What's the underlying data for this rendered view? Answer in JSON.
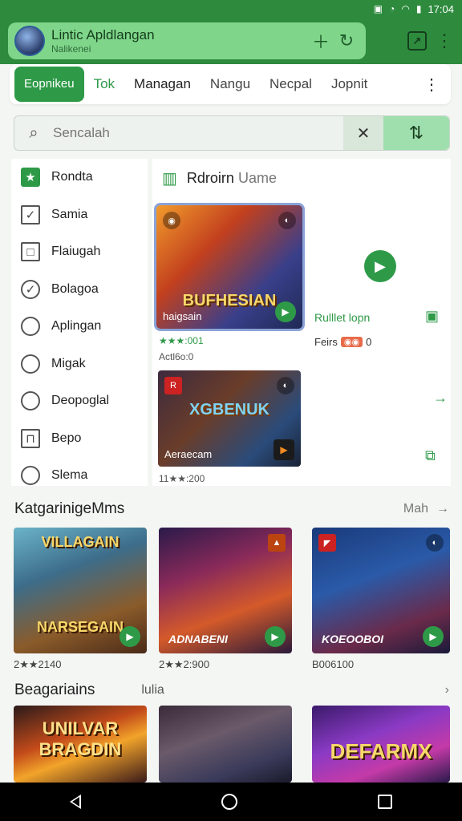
{
  "status": {
    "time": "17:04"
  },
  "header": {
    "title": "Lintic Apldlangan",
    "subtitle": "Nalikenei"
  },
  "tabs": [
    "Eopnikeu",
    "Tok",
    "Managan",
    "Nangu",
    "Necpal",
    "Jopnit"
  ],
  "search": {
    "placeholder": "Sencalah"
  },
  "sidebar": {
    "items": [
      {
        "label": "Rondta",
        "icon": "star-icon"
      },
      {
        "label": "Samia",
        "icon": "check-square-icon"
      },
      {
        "label": "Flaiugah",
        "icon": "square-icon"
      },
      {
        "label": "Bolagoa",
        "icon": "check-circle-icon"
      },
      {
        "label": "Aplingan",
        "icon": "circle-icon"
      },
      {
        "label": "Migak",
        "icon": "circle-icon"
      },
      {
        "label": "Deopoglal",
        "icon": "circle-icon"
      },
      {
        "label": "Bepo",
        "icon": "square-icon"
      },
      {
        "label": "Slema",
        "icon": "circle-icon"
      }
    ]
  },
  "main": {
    "section_title": "Rdroirn",
    "section_title_light": "Uame",
    "featured": {
      "art_title": "BUFHESIAN",
      "label": "haigsain",
      "rating": "★★★:001",
      "meta": "Actl6o:0"
    },
    "second": {
      "art_title": "XGBENUK",
      "label": "Aeraecam",
      "rating": "11★★:200"
    },
    "side_label": "Rulllet lopn",
    "side_meta_prefix": "Feirs",
    "side_meta_value": "0"
  },
  "row1": {
    "title": "KatgarinigeMms",
    "more": "Mah",
    "games": [
      {
        "art_title": "VILLAGAIN",
        "label": "NARSEGAIN",
        "meta": "2★★2140"
      },
      {
        "art_title": "",
        "label": "ADNABENI",
        "meta": "2★★2:900"
      },
      {
        "art_title": "",
        "label": "KOEOOBOI",
        "meta": "B006100"
      }
    ]
  },
  "row2": {
    "title": "Beagariains",
    "sub": "lulia",
    "games": [
      {
        "art_title": "UNILVAR BRAGDIN"
      },
      {
        "art_title": ""
      },
      {
        "art_title": "DEFARMX"
      }
    ]
  }
}
